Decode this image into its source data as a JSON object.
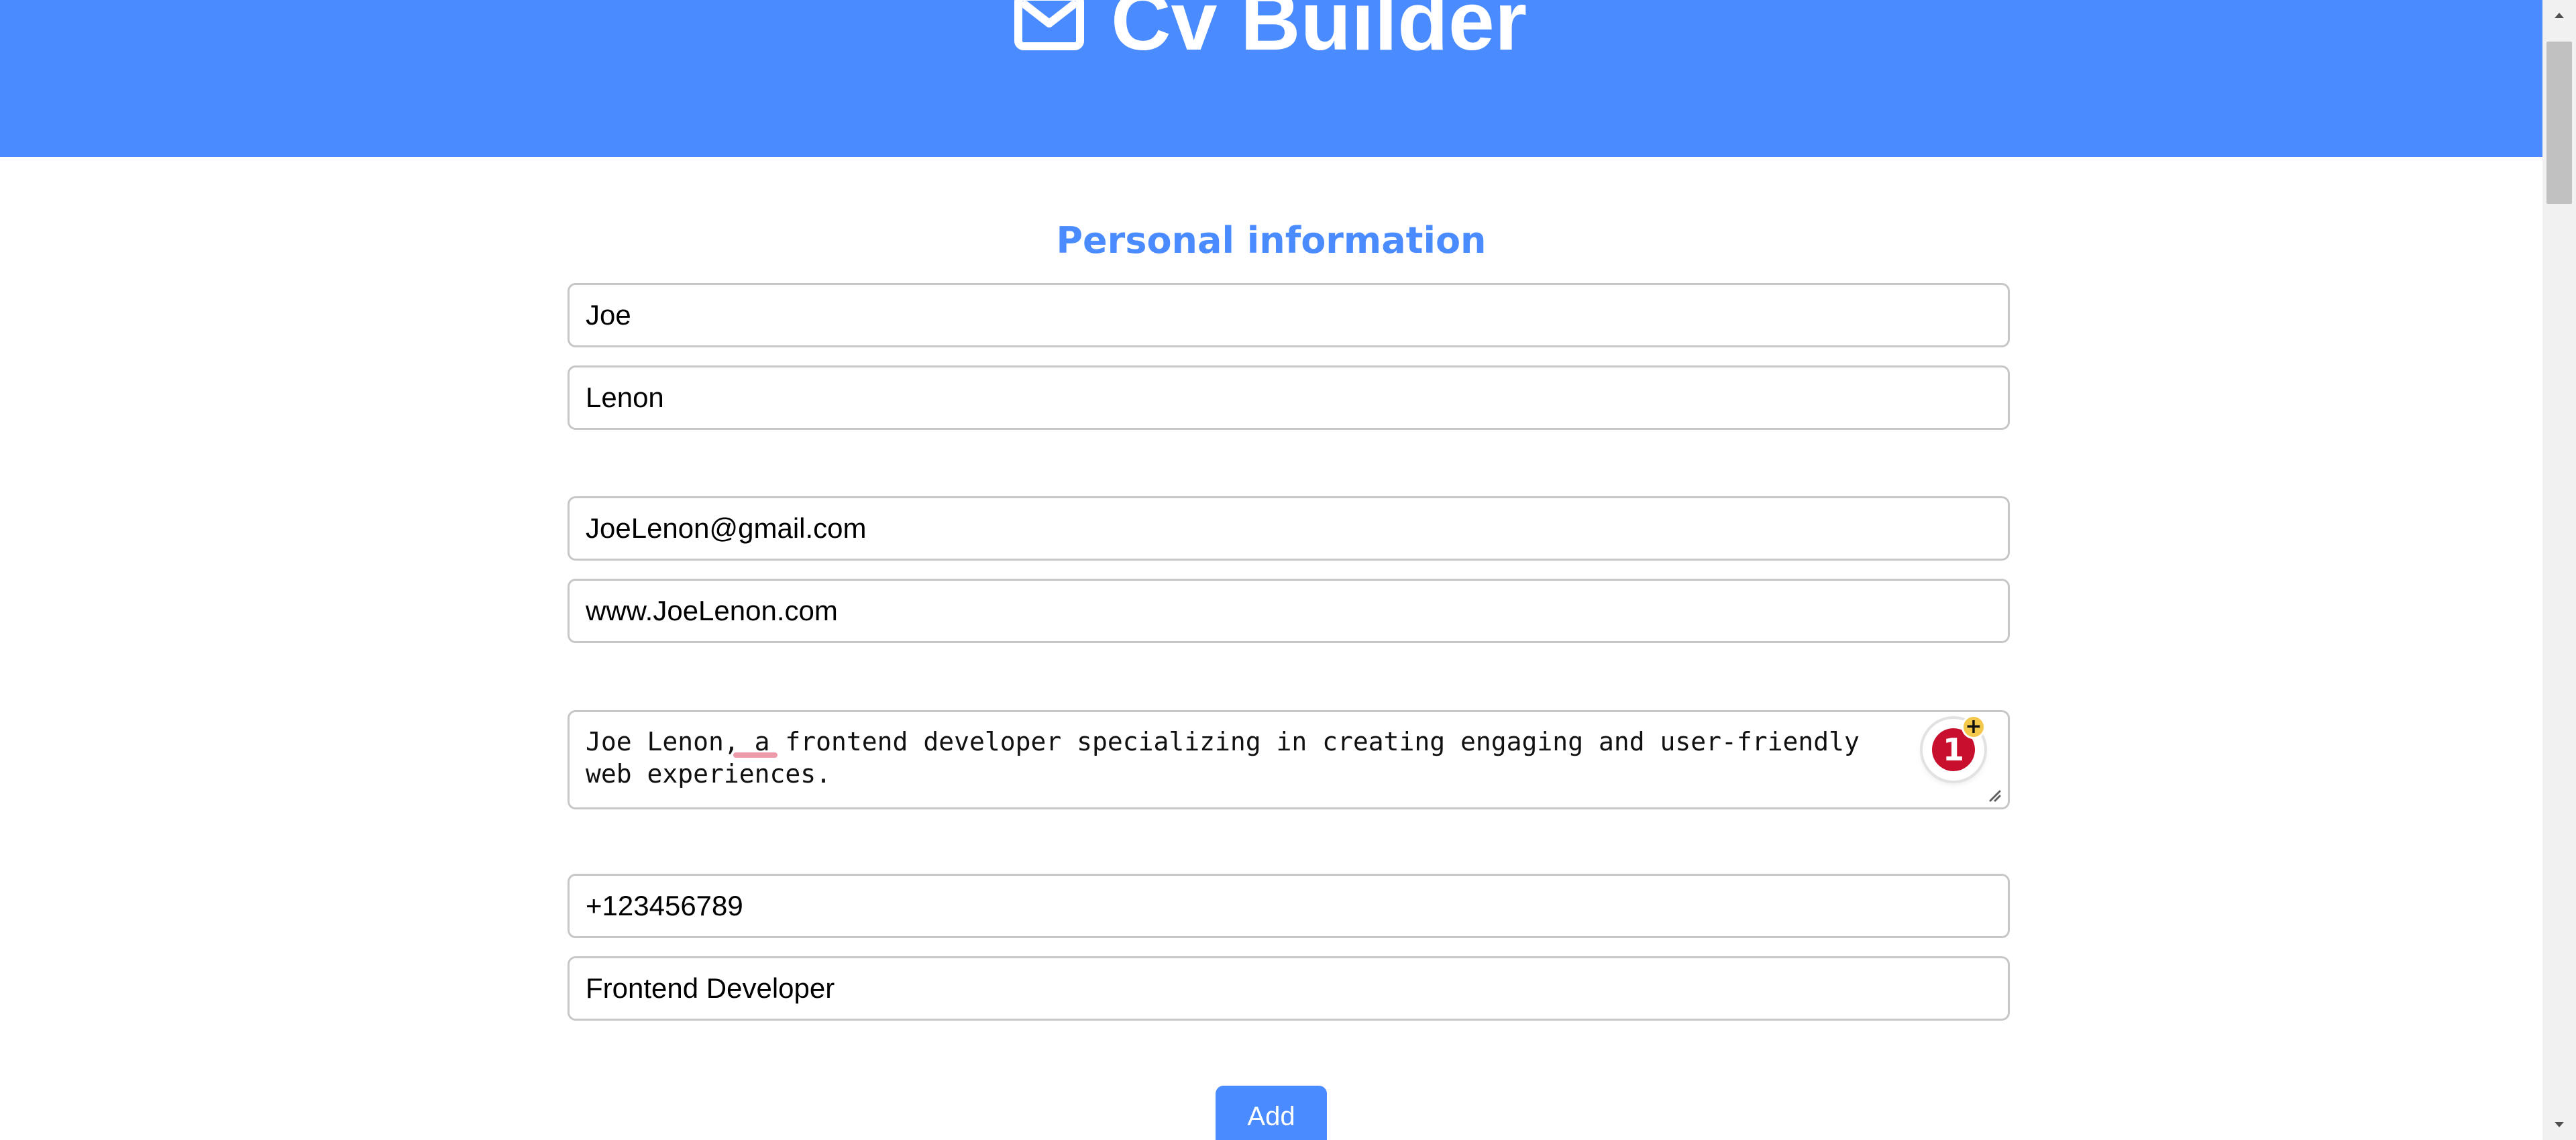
{
  "header": {
    "title": "Cv Builder",
    "icon": "mail-icon"
  },
  "personal_information": {
    "heading": "Personal information",
    "first_name": "Joe",
    "last_name": "Lenon",
    "email": "JoeLenon@gmail.com",
    "website": "www.JoeLenon.com",
    "bio": "Joe Lenon, a frontend developer specializing in creating engaging and user-friendly web experiences.",
    "phone": "+123456789",
    "job_title": "Frontend Developer"
  },
  "extension_badge": {
    "count": "1",
    "plus": "+"
  },
  "actions": {
    "add_label": "Add"
  },
  "colors": {
    "accent": "#4a8cff",
    "field_border": "#c7c7c7",
    "badge_red": "#c8102e",
    "badge_yellow": "#f4c84b"
  }
}
